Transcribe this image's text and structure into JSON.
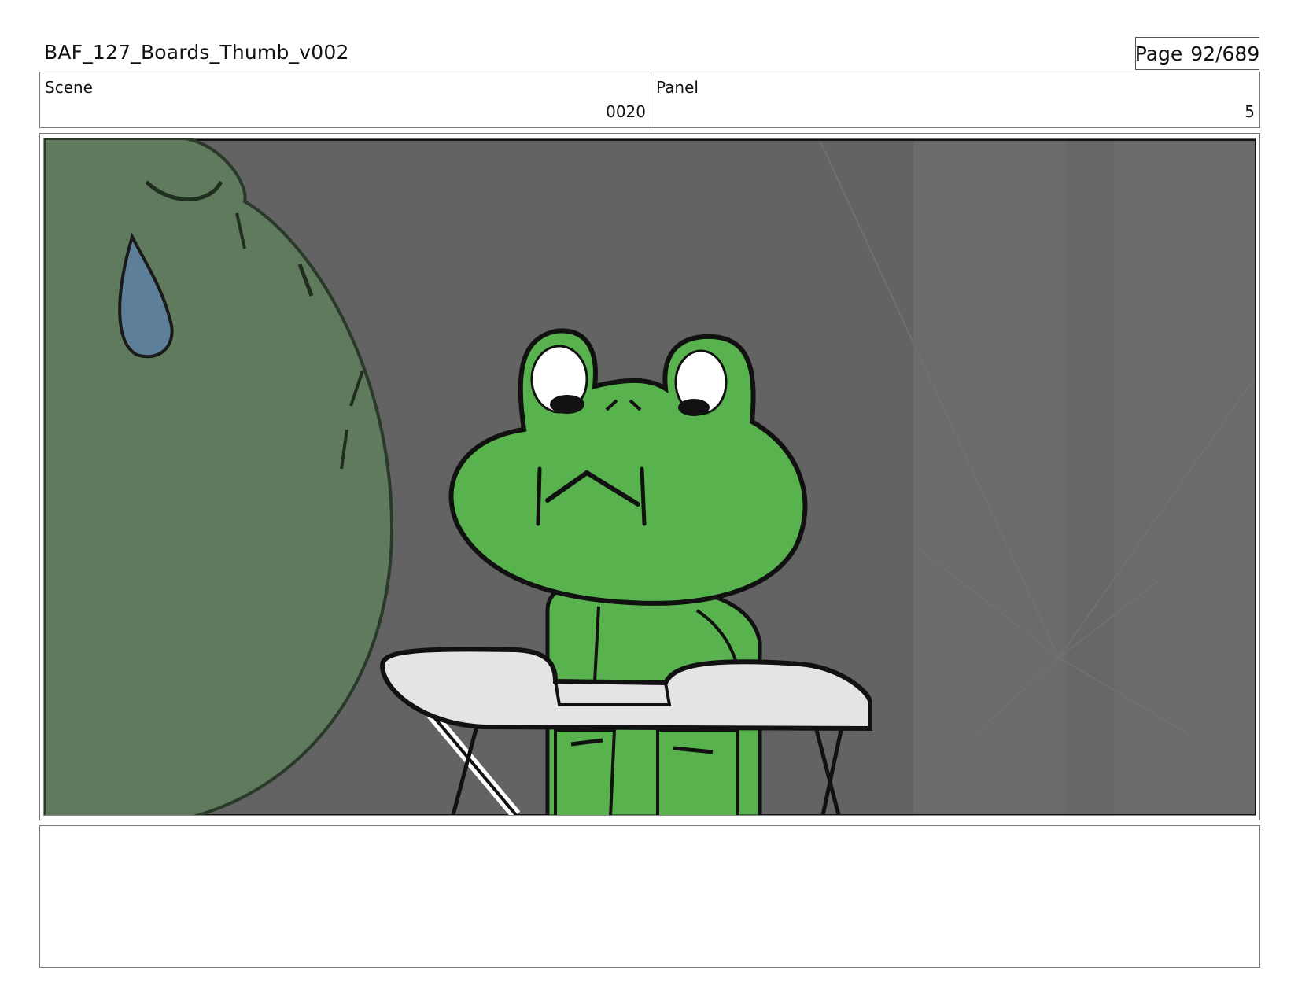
{
  "header": {
    "title": "BAF_127_Boards_Thumb_v002",
    "page_label": "Page",
    "page_number": "92/689"
  },
  "info": {
    "scene_label": "Scene",
    "scene_value": "0020",
    "panel_label": "Panel",
    "panel_value": "5"
  },
  "notes": {
    "text": ""
  },
  "colors": {
    "background": "#636363",
    "frog_green": "#58b24e",
    "foreground_creature": "#5f7a5c",
    "sweat_drop": "#5e7f9a",
    "desk": "#e4e4e4"
  }
}
